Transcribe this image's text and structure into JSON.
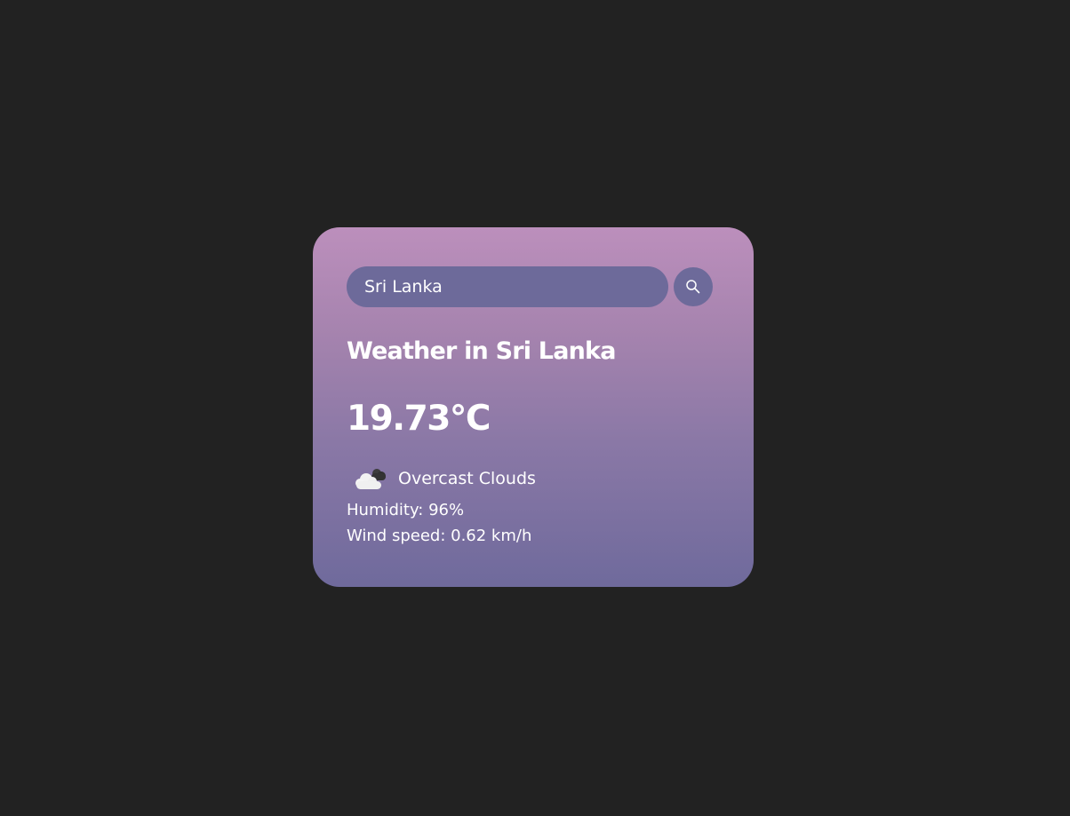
{
  "search": {
    "value": "Sri Lanka",
    "button_icon": "search-icon"
  },
  "weather": {
    "title": "Weather in Sri Lanka",
    "temperature": "19.73°C",
    "icon": "overcast-clouds-icon",
    "description": "Overcast Clouds",
    "humidity": "Humidity: 96%",
    "wind": "Wind speed: 0.62 km/h"
  },
  "colors": {
    "page_background": "#222222",
    "card_top": "#bc8fbc",
    "card_bottom": "#6f6a9c",
    "input_background": "#6d6a9a",
    "text": "#ffffff"
  }
}
